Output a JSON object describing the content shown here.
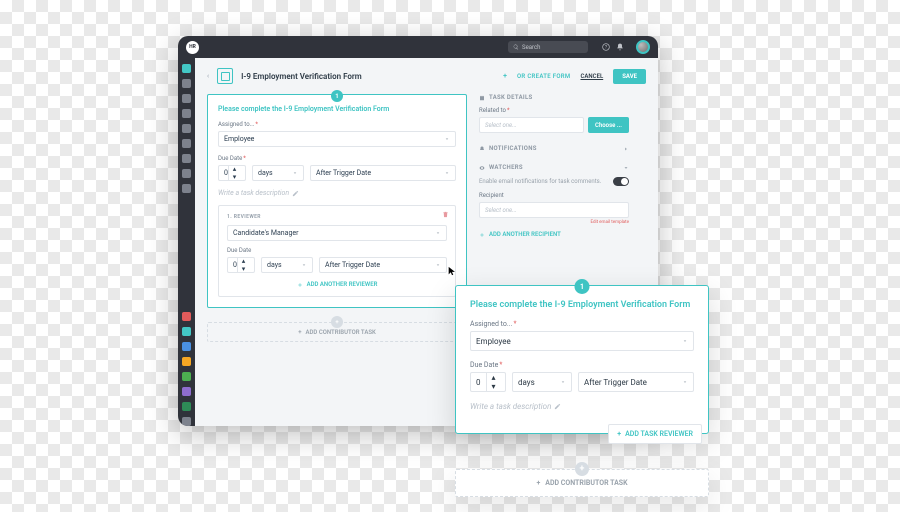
{
  "topbar": {
    "badge": "HR",
    "search_placeholder": "Search"
  },
  "header": {
    "title": "I-9 Employment Verification Form",
    "create_form": "OR CREATE FORM",
    "cancel": "CANCEL",
    "save": "SAVE"
  },
  "card": {
    "step": "1",
    "heading": "Please complete the I-9 Employment Verification Form",
    "assigned_label": "Assigned to...",
    "assigned_value": "Employee",
    "due_label": "Due Date",
    "due_qty": "0",
    "due_unit": "days",
    "due_rel": "After Trigger Date",
    "desc_placeholder": "Write a task description"
  },
  "reviewer": {
    "section_label": "1. REVIEWER",
    "value": "Candidate's Manager",
    "due_label": "Due Date",
    "due_qty": "0",
    "due_unit": "days",
    "due_rel": "After Trigger Date",
    "add": "ADD ANOTHER REVIEWER"
  },
  "contrib": {
    "plus": "+",
    "label": "ADD CONTRIBUTOR TASK"
  },
  "side": {
    "details": "TASK DETAILS",
    "related_label": "Related to",
    "related_placeholder": "Select one...",
    "choose": "Choose ...",
    "notif": "NOTIFICATIONS",
    "watchers": "WATCHERS",
    "watch_text": "Enable email notifications for task comments.",
    "recipient_label": "Recipient",
    "recipient_placeholder": "Select one...",
    "edit_template": "Edit email template",
    "add_recipient": "ADD ANOTHER RECIPIENT"
  },
  "float": {
    "step": "1",
    "heading": "Please complete the I-9 Employment Verification Form",
    "assigned_label": "Assigned to...",
    "assigned_value": "Employee",
    "due_label": "Due Date",
    "due_qty": "0",
    "due_unit": "days",
    "due_rel": "After Trigger Date",
    "desc_placeholder": "Write a task description",
    "add_reviewer": "ADD TASK REVIEWER"
  },
  "float2": {
    "plus": "+",
    "label": "ADD CONTRIBUTOR TASK"
  }
}
